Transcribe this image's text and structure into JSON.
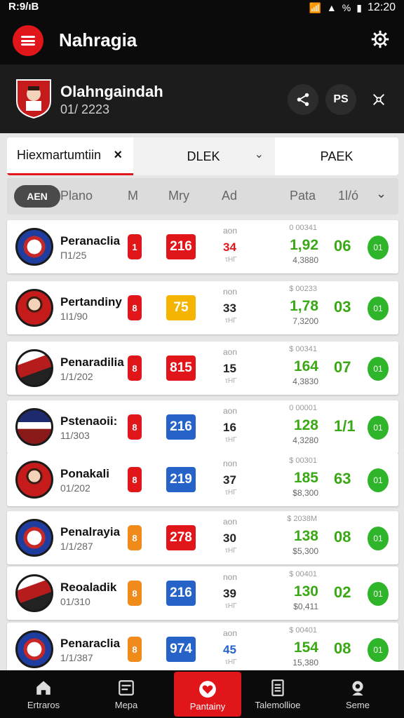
{
  "status": {
    "left": "R:9/ıB",
    "time": "12:20",
    "pct": "%"
  },
  "app": {
    "title": "Nahragia"
  },
  "profile": {
    "name": "Olahngaindah",
    "sub": "01/ 2223",
    "btn_ps": "PS"
  },
  "tabs": {
    "active": "Hiexmartumtiin",
    "close": "×",
    "second": "DLEK",
    "third": "PAEK"
  },
  "header": {
    "pill": "AEN",
    "cols": [
      "Plano",
      "M",
      "Mry",
      "Ad",
      "Pata",
      "1l/ó"
    ]
  },
  "rows": [
    {
      "name": "Peranaclia",
      "date": "Π1/25",
      "tag": "1",
      "score": "216",
      "mid_top": "aon",
      "mid": "34",
      "mid_bot": "τΗΓ",
      "odds_top": "0 00341",
      "odds": "1,92",
      "odds_bot": "4,3880",
      "pts": "06",
      "go": "01"
    },
    {
      "name": "Pertandiny",
      "date": "1Ι1/90",
      "tag": "8",
      "score": "75",
      "mid_top": "non",
      "mid": "33",
      "mid_bot": "τΗΓ",
      "odds_top": "$ 00233",
      "odds": "1,78",
      "odds_bot": "7,3200",
      "pts": "03",
      "go": "01"
    },
    {
      "name": "Penaradilia",
      "date": "1/1/202",
      "tag": "8",
      "score": "815",
      "mid_top": "aon",
      "mid": "15",
      "mid_bot": "τΗΓ",
      "odds_top": "$ 00341",
      "odds": "164",
      "odds_bot": "4,3830",
      "pts": "07",
      "go": "01"
    },
    {
      "name": "Pstenaoii:",
      "date": "11/303",
      "tag": "8",
      "score": "216",
      "mid_top": "aon",
      "mid": "16",
      "mid_bot": "τΗΓ",
      "odds_top": "0 00001",
      "odds": "128",
      "odds_bot": "4,3280",
      "pts": "1/1",
      "go": "01"
    },
    {
      "name": "Ponakali",
      "date": "01/202",
      "tag": "8",
      "score": "219",
      "mid_top": "non",
      "mid": "37",
      "mid_bot": "τΗΓ",
      "odds_top": "$ 00301",
      "odds": "185",
      "odds_bot": "$8,300",
      "pts": "63",
      "go": "01"
    },
    {
      "name": "Penalrayia",
      "date": "1/1/287",
      "tag": "8",
      "score": "278",
      "mid_top": "aon",
      "mid": "30",
      "mid_bot": "τΗΓ",
      "odds_top": "$ 2038M",
      "odds": "138",
      "odds_bot": "$5,300",
      "pts": "08",
      "go": "01"
    },
    {
      "name": "Reoaladik",
      "date": "01/310",
      "tag": "8",
      "score": "216",
      "mid_top": "non",
      "mid": "39",
      "mid_bot": "τΗΓ",
      "odds_top": "$ 00401",
      "odds": "130",
      "odds_bot": "$0,411",
      "pts": "02",
      "go": "01"
    },
    {
      "name": "Penaraclia",
      "date": "1/1/387",
      "tag": "8",
      "score": "974",
      "mid_top": "aon",
      "mid": "45",
      "mid_bot": "τΗΓ",
      "odds_top": "$ 00401",
      "odds": "154",
      "odds_bot": "15,380",
      "pts": "08",
      "go": "01"
    }
  ],
  "nav": [
    {
      "label": "Ertraros",
      "icon": "home-icon"
    },
    {
      "label": "Mepa",
      "icon": "map-icon"
    },
    {
      "label": "Pantainy",
      "icon": "heart-icon"
    },
    {
      "label": "Talemollioe",
      "icon": "document-icon"
    },
    {
      "label": "Seme",
      "icon": "user-icon"
    }
  ],
  "colors": {
    "accent": "#e0161b",
    "green": "#3aa815",
    "tag_red": "#e0161b",
    "tag_orange": "#f08a1a",
    "score_red": "#e0161b",
    "score_yellow": "#f4b400",
    "score_blue": "#2563c9"
  }
}
